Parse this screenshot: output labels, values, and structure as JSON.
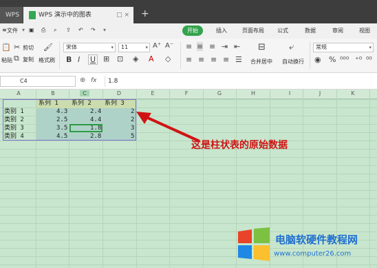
{
  "titlebar": {
    "tab_wps": "WPS",
    "tab_doc": "WPS 演示中的图表",
    "tab_add": "+"
  },
  "menu": {
    "file": "文件",
    "items": [
      "开始",
      "插入",
      "页面布局",
      "公式",
      "数据",
      "审阅",
      "视图"
    ]
  },
  "toolbar": {
    "cut": "剪切",
    "copy": "复制",
    "paste": "粘贴",
    "format_painter": "格式刷",
    "font_name": "宋体",
    "font_size": "11",
    "merge": "合并居中",
    "wrap": "自动换行",
    "number_format": "常规"
  },
  "formula": {
    "cell_ref": "C4",
    "fx": "fx",
    "value": "1.8"
  },
  "columns": [
    "A",
    "B",
    "C",
    "D",
    "E",
    "F",
    "G",
    "H",
    "I",
    "J",
    "K"
  ],
  "table": {
    "headers": [
      "系列 1",
      "系列 2",
      "系列 3"
    ],
    "rows": [
      {
        "label": "类别 1",
        "values": [
          "4.3",
          "2.4",
          "2"
        ]
      },
      {
        "label": "类别 2",
        "values": [
          "2.5",
          "4.4",
          "2"
        ]
      },
      {
        "label": "类别 3",
        "values": [
          "3.5",
          "1.8",
          "3"
        ]
      },
      {
        "label": "类别 4",
        "values": [
          "4.5",
          "2.8",
          "5"
        ]
      }
    ]
  },
  "annotation": "这是柱状表的原始数据",
  "watermark": {
    "title": "电脑软硬件教程网",
    "url": "www.computer26.com"
  },
  "colors": {
    "accent": "#33a34c",
    "sheet_bg": "#c7e6cd",
    "annotation": "#d01414"
  }
}
